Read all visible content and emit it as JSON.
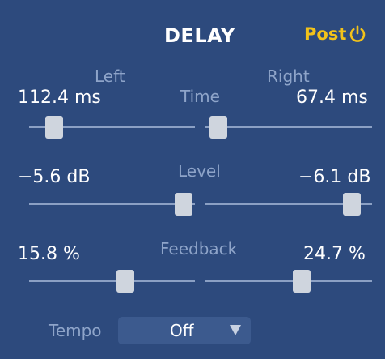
{
  "header": {
    "title": "DELAY",
    "post_label": "Post",
    "post_icon": "power-icon",
    "accent_color": "#f2c21a"
  },
  "time": {
    "label": "Time",
    "left_label": "Left",
    "right_label": "Right",
    "left_value": "112.4 ms",
    "right_value": "67.4 ms",
    "left_fraction": 0.15,
    "right_fraction": 0.08
  },
  "level": {
    "label": "Level",
    "left_value": "−5.6 dB",
    "right_value": "−6.1 dB",
    "left_fraction": 0.93,
    "right_fraction": 0.88
  },
  "feedback": {
    "label": "Feedback",
    "left_value": "15.8 %",
    "right_value": "24.7 %",
    "left_fraction": 0.58,
    "right_fraction": 0.58
  },
  "tempo": {
    "label": "Tempo",
    "value": "Off"
  },
  "colors": {
    "background": "#2d4a7d",
    "slider_thumb": "#cfd5de",
    "slider_track": "#8ba0c4",
    "dim_label": "#8ea4c9"
  }
}
